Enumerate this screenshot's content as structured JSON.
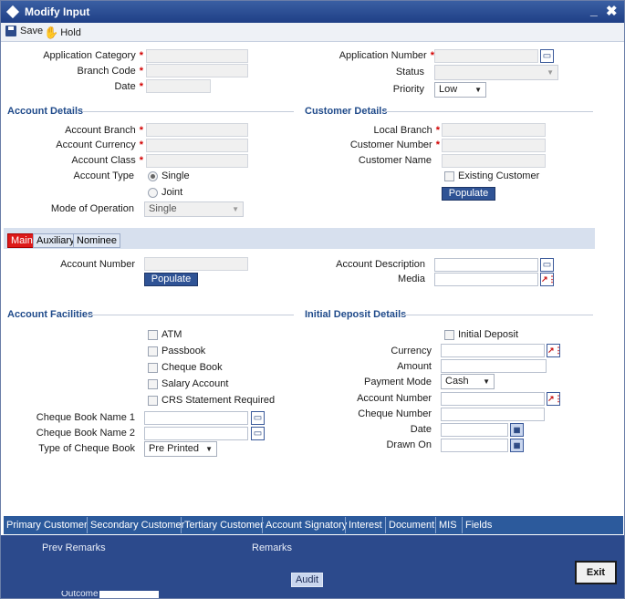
{
  "window": {
    "title": "Modify Input",
    "minimize": "_",
    "close": "✖"
  },
  "toolbar": {
    "save_label": "Save",
    "hold_label": "Hold"
  },
  "header": {
    "application_category": "Application Category",
    "branch_code": "Branch Code",
    "date": "Date",
    "application_number": "Application Number",
    "status": "Status",
    "priority": "Priority",
    "priority_value": "Low",
    "required_mark": "*"
  },
  "account_details": {
    "section_title": "Account Details",
    "account_branch": "Account Branch",
    "account_currency": "Account Currency",
    "account_class": "Account Class",
    "account_type": "Account Type",
    "type_single": "Single",
    "type_joint": "Joint",
    "mode_of_operation": "Mode of Operation",
    "mode_value": "Single"
  },
  "customer_details": {
    "section_title": "Customer Details",
    "local_branch": "Local Branch",
    "customer_number": "Customer Number",
    "customer_name": "Customer Name",
    "existing_customer": "Existing Customer",
    "populate": "Populate"
  },
  "tabs": {
    "main": "Main",
    "auxiliary": "Auxiliary",
    "nominee": "Nominee"
  },
  "main": {
    "account_number": "Account Number",
    "populate": "Populate",
    "account_description": "Account Description",
    "media": "Media"
  },
  "account_facilities": {
    "section_title": "Account Facilities",
    "atm": "ATM",
    "passbook": "Passbook",
    "cheque_book": "Cheque Book",
    "salary_account": "Salary Account",
    "crs_statement": "CRS Statement Required",
    "cheque_book_name_1": "Cheque Book Name 1",
    "cheque_book_name_2": "Cheque Book Name 2",
    "type_of_cheque_book": "Type of Cheque Book",
    "type_value": "Pre Printed"
  },
  "initial_deposit": {
    "section_title": "Initial Deposit Details",
    "initial_deposit": "Initial Deposit",
    "currency": "Currency",
    "amount": "Amount",
    "payment_mode": "Payment Mode",
    "payment_mode_value": "Cash",
    "account_number": "Account Number",
    "cheque_number": "Cheque Number",
    "date": "Date",
    "drawn_on": "Drawn On"
  },
  "bottom_tabs": [
    "Primary Customer",
    "Secondary Customer",
    "Tertiary Customer",
    "Account Signatory",
    "Interest",
    "Document",
    "MIS",
    "Fields"
  ],
  "footer": {
    "prev_remarks": "Prev Remarks",
    "remarks": "Remarks",
    "audit": "Audit",
    "exit": "Exit",
    "outcome": "Outcome"
  }
}
